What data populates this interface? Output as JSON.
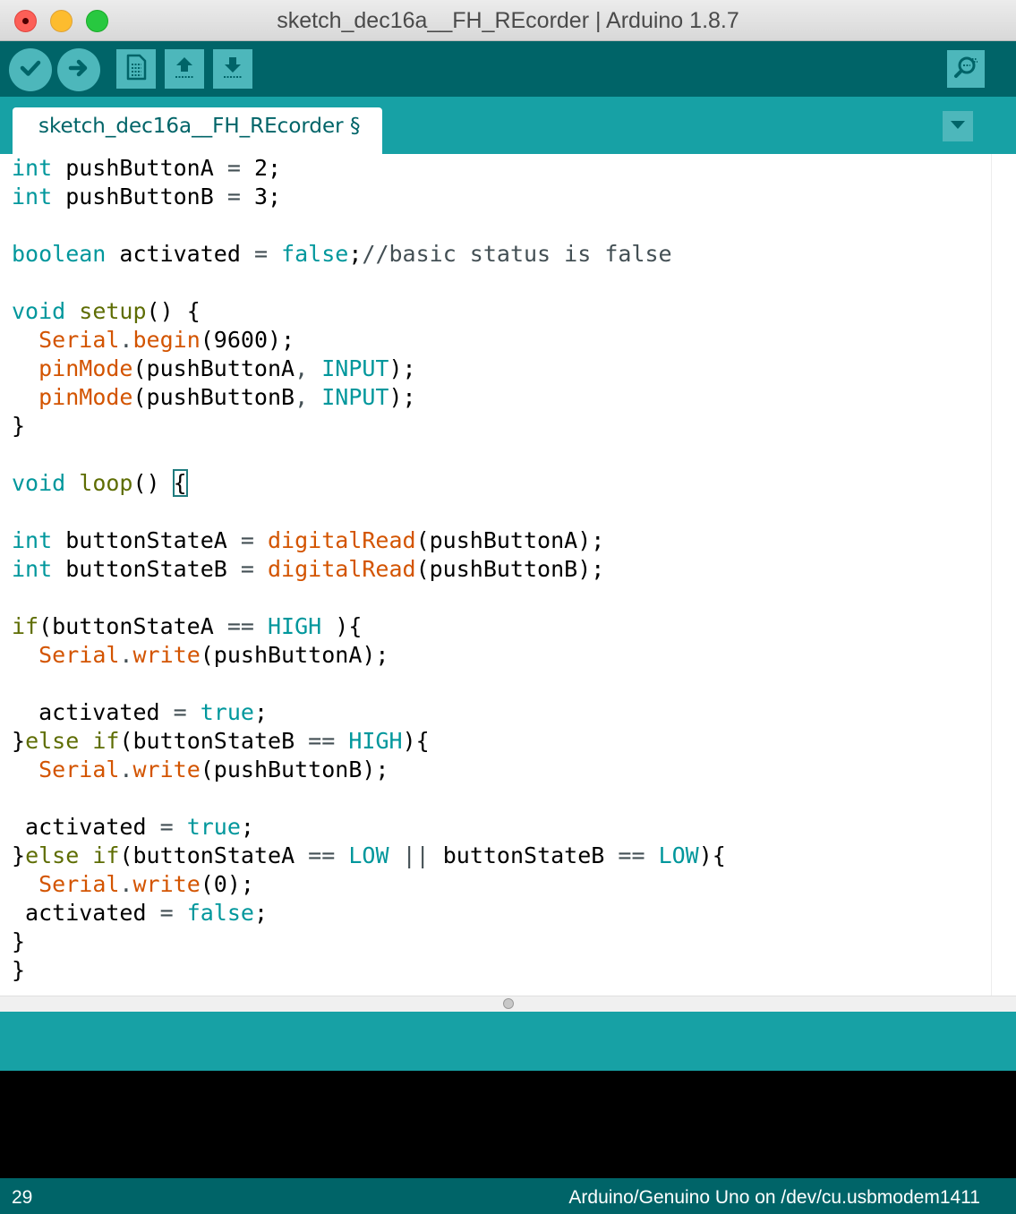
{
  "window": {
    "title": "sketch_dec16a__FH_REcorder | Arduino 1.8.7"
  },
  "toolbar": {
    "buttons": [
      {
        "name": "verify",
        "icon": "checkmark-icon"
      },
      {
        "name": "upload",
        "icon": "arrow-right-icon"
      },
      {
        "name": "new",
        "icon": "new-file-icon"
      },
      {
        "name": "open",
        "icon": "arrow-up-icon"
      },
      {
        "name": "save",
        "icon": "arrow-down-icon"
      },
      {
        "name": "serial-monitor",
        "icon": "magnifier-icon"
      }
    ]
  },
  "tab": {
    "label": "sketch_dec16a__FH_REcorder §"
  },
  "editor": {
    "lines": [
      [
        [
          "type",
          "int"
        ],
        [
          "default",
          " pushButtonA "
        ],
        [
          "op",
          "="
        ],
        [
          "default",
          " 2;"
        ]
      ],
      [
        [
          "type",
          "int"
        ],
        [
          "default",
          " pushButtonB "
        ],
        [
          "op",
          "="
        ],
        [
          "default",
          " 3;"
        ]
      ],
      [],
      [
        [
          "type",
          "boolean"
        ],
        [
          "default",
          " activated "
        ],
        [
          "op",
          "="
        ],
        [
          "default",
          " "
        ],
        [
          "const",
          "false"
        ],
        [
          "default",
          ";"
        ],
        [
          "comment",
          "//basic status is false"
        ]
      ],
      [],
      [
        [
          "type",
          "void"
        ],
        [
          "default",
          " "
        ],
        [
          "func",
          "setup"
        ],
        [
          "default",
          "() {"
        ]
      ],
      [
        [
          "default",
          "  "
        ],
        [
          "lib",
          "Serial"
        ],
        [
          "op",
          "."
        ],
        [
          "lib",
          "begin"
        ],
        [
          "default",
          "(9600);"
        ]
      ],
      [
        [
          "default",
          "  "
        ],
        [
          "lib",
          "pinMode"
        ],
        [
          "default",
          "(pushButtonA"
        ],
        [
          "op",
          ","
        ],
        [
          "default",
          " "
        ],
        [
          "const",
          "INPUT"
        ],
        [
          "default",
          ");"
        ]
      ],
      [
        [
          "default",
          "  "
        ],
        [
          "lib",
          "pinMode"
        ],
        [
          "default",
          "(pushButtonB"
        ],
        [
          "op",
          ","
        ],
        [
          "default",
          " "
        ],
        [
          "const",
          "INPUT"
        ],
        [
          "default",
          ");"
        ]
      ],
      [
        [
          "default",
          "}"
        ]
      ],
      [],
      [
        [
          "type",
          "void"
        ],
        [
          "default",
          " "
        ],
        [
          "func",
          "loop"
        ],
        [
          "default",
          "() "
        ],
        [
          "bracket",
          "{"
        ]
      ],
      [],
      [
        [
          "type",
          "int"
        ],
        [
          "default",
          " buttonStateA "
        ],
        [
          "op",
          "="
        ],
        [
          "default",
          " "
        ],
        [
          "lib",
          "digitalRead"
        ],
        [
          "default",
          "(pushButtonA);"
        ]
      ],
      [
        [
          "type",
          "int"
        ],
        [
          "default",
          " buttonStateB "
        ],
        [
          "op",
          "="
        ],
        [
          "default",
          " "
        ],
        [
          "lib",
          "digitalRead"
        ],
        [
          "default",
          "(pushButtonB);"
        ]
      ],
      [],
      [
        [
          "func",
          "if"
        ],
        [
          "default",
          "(buttonStateA "
        ],
        [
          "op",
          "=="
        ],
        [
          "default",
          " "
        ],
        [
          "const",
          "HIGH"
        ],
        [
          "default",
          " ){"
        ]
      ],
      [
        [
          "default",
          "  "
        ],
        [
          "lib",
          "Serial"
        ],
        [
          "op",
          "."
        ],
        [
          "lib",
          "write"
        ],
        [
          "default",
          "(pushButtonA);"
        ]
      ],
      [],
      [
        [
          "default",
          "  activated "
        ],
        [
          "op",
          "="
        ],
        [
          "default",
          " "
        ],
        [
          "const",
          "true"
        ],
        [
          "default",
          ";"
        ]
      ],
      [
        [
          "default",
          "}"
        ],
        [
          "func",
          "else"
        ],
        [
          "default",
          " "
        ],
        [
          "func",
          "if"
        ],
        [
          "default",
          "(buttonStateB "
        ],
        [
          "op",
          "=="
        ],
        [
          "default",
          " "
        ],
        [
          "const",
          "HIGH"
        ],
        [
          "default",
          "){"
        ]
      ],
      [
        [
          "default",
          "  "
        ],
        [
          "lib",
          "Serial"
        ],
        [
          "op",
          "."
        ],
        [
          "lib",
          "write"
        ],
        [
          "default",
          "(pushButtonB);"
        ]
      ],
      [],
      [
        [
          "default",
          " activated "
        ],
        [
          "op",
          "="
        ],
        [
          "default",
          " "
        ],
        [
          "const",
          "true"
        ],
        [
          "default",
          ";"
        ]
      ],
      [
        [
          "default",
          "}"
        ],
        [
          "func",
          "else"
        ],
        [
          "default",
          " "
        ],
        [
          "func",
          "if"
        ],
        [
          "default",
          "(buttonStateA "
        ],
        [
          "op",
          "=="
        ],
        [
          "default",
          " "
        ],
        [
          "const",
          "LOW"
        ],
        [
          "default",
          " "
        ],
        [
          "op",
          "||"
        ],
        [
          "default",
          " buttonStateB "
        ],
        [
          "op",
          "=="
        ],
        [
          "default",
          " "
        ],
        [
          "const",
          "LOW"
        ],
        [
          "default",
          "){"
        ]
      ],
      [
        [
          "default",
          "  "
        ],
        [
          "lib",
          "Serial"
        ],
        [
          "op",
          "."
        ],
        [
          "lib",
          "write"
        ],
        [
          "default",
          "(0);"
        ]
      ],
      [
        [
          "default",
          " activated "
        ],
        [
          "op",
          "="
        ],
        [
          "default",
          " "
        ],
        [
          "const",
          "false"
        ],
        [
          "default",
          ";"
        ]
      ],
      [
        [
          "default",
          "}"
        ]
      ],
      [
        [
          "default",
          "}"
        ]
      ]
    ]
  },
  "statusbar": {
    "line_number": "29",
    "board": "Arduino/Genuino Uno on /dev/cu.usbmodem1411"
  },
  "colors": {
    "toolbar_bg": "#006468",
    "tabbar_bg": "#17a1a5",
    "button_bg": "#4db7bb",
    "keyword_type": "#00979c",
    "keyword_func": "#5e6d03",
    "library": "#d35400",
    "comment": "#434f54"
  }
}
